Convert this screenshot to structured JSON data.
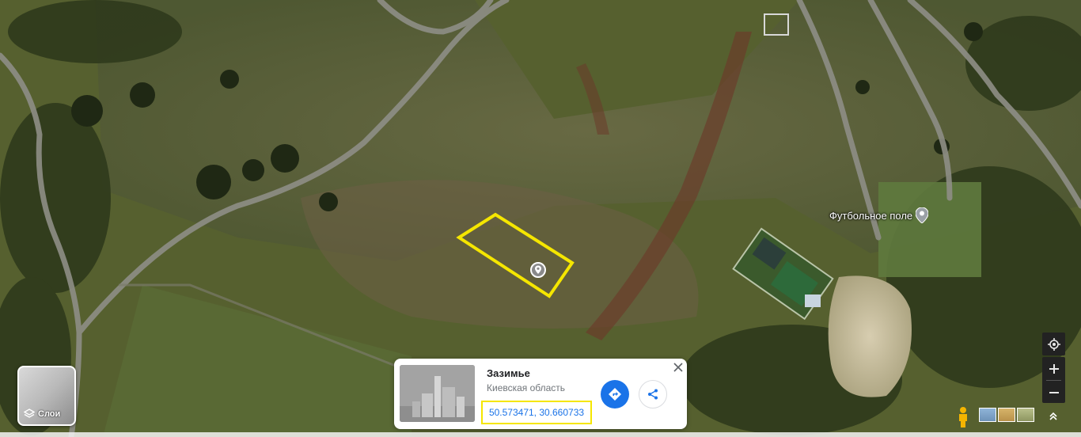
{
  "map": {
    "view": "satellite",
    "place_label": "Футбольное поле"
  },
  "layers": {
    "label": "Слои"
  },
  "card": {
    "title": "Зазимье",
    "subtitle": "Киевская область",
    "coordinates": "50.573471, 30.660733",
    "coordinates_highlight_color": "#f5e600"
  },
  "colors": {
    "accent": "#1a73e8",
    "highlight": "#f5e600"
  },
  "icons": {
    "pin": "map-pin-icon",
    "directions": "directions-icon",
    "share": "share-icon",
    "close": "close-icon",
    "layers": "layers-icon",
    "location": "my-location-icon",
    "pegman": "pegman-icon",
    "expand": "chevron-up-icon"
  }
}
